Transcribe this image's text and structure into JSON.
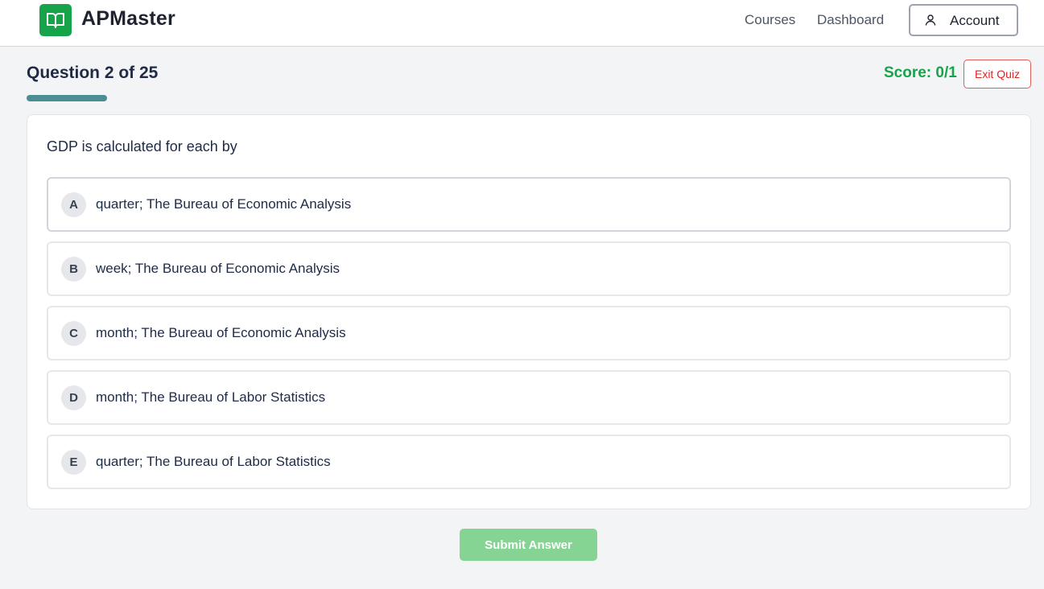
{
  "header": {
    "brand": "APMaster",
    "logo_icon": "open-book-icon",
    "nav": {
      "courses": "Courses",
      "dashboard": "Dashboard"
    },
    "account_label": "Account",
    "account_icon": "user-icon"
  },
  "quiz": {
    "question_counter": "Question 2 of 25",
    "progress_fraction": 0.08,
    "score": "Score: 0/1",
    "exit_label": "Exit Quiz"
  },
  "question": {
    "text": "GDP is calculated for each by",
    "options": [
      {
        "letter": "A",
        "text": "quarter; The Bureau of Economic Analysis"
      },
      {
        "letter": "B",
        "text": "week; The Bureau of Economic Analysis"
      },
      {
        "letter": "C",
        "text": "month; The Bureau of Economic Analysis"
      },
      {
        "letter": "D",
        "text": "month; The Bureau of Labor Statistics"
      },
      {
        "letter": "E",
        "text": "quarter; The Bureau of Labor Statistics"
      }
    ]
  },
  "submit_label": "Submit Answer",
  "colors": {
    "brand_green": "#16a34a",
    "progress": "#4a8e93",
    "submit_disabled": "#86d494",
    "exit_red": "#dc2626"
  }
}
